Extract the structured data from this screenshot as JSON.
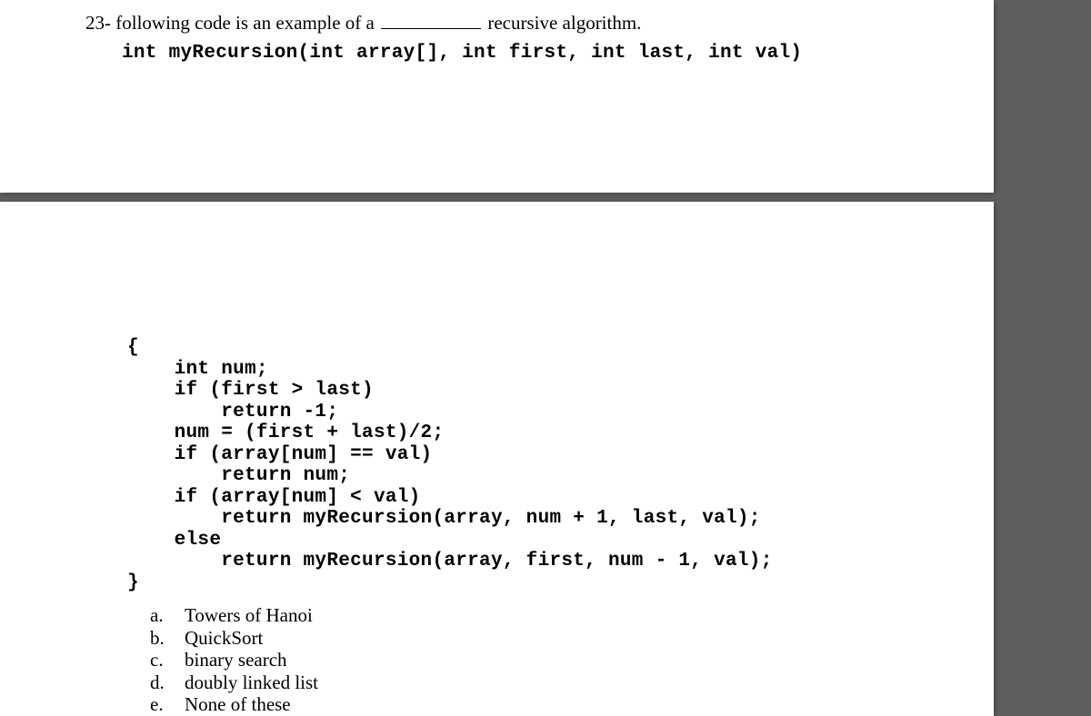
{
  "question": {
    "number": "23-",
    "text_before_blank": "following code is an example of a ",
    "text_after_blank": " recursive algorithm."
  },
  "code_signature": "int myRecursion(int array[], int first, int last, int val)",
  "code_body": "{\n    int num;\n    if (first > last)\n        return -1;\n    num = (first + last)/2;\n    if (array[num] == val)\n        return num;\n    if (array[num] < val)\n        return myRecursion(array, num + 1, last, val);\n    else\n        return myRecursion(array, first, num - 1, val);\n}",
  "options": [
    {
      "letter": "a.",
      "text": "Towers of Hanoi"
    },
    {
      "letter": "b.",
      "text": "QuickSort"
    },
    {
      "letter": "c.",
      "text": "binary search"
    },
    {
      "letter": "d.",
      "text": "doubly linked list"
    },
    {
      "letter": "e.",
      "text": "None of these"
    }
  ]
}
